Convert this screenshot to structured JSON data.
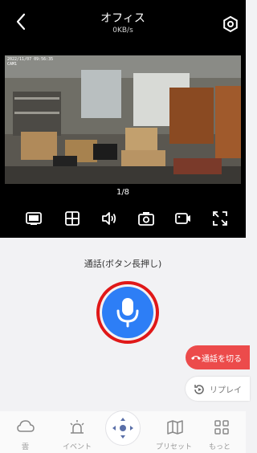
{
  "header": {
    "title": "オフィス",
    "bitrate": "0KB/s",
    "back_icon": "chevron-left-icon",
    "settings_icon": "gear-icon"
  },
  "video": {
    "timestamp": "2022/11/07 09:56:35",
    "camera_label": "CAM1",
    "page_indicator": "1/8"
  },
  "controls": [
    {
      "name": "sd-quality-button",
      "icon": "sd-icon"
    },
    {
      "name": "grid-layout-button",
      "icon": "grid-icon"
    },
    {
      "name": "sound-button",
      "icon": "speaker-icon"
    },
    {
      "name": "snapshot-button",
      "icon": "camera-icon"
    },
    {
      "name": "record-button",
      "icon": "video-record-icon"
    },
    {
      "name": "fullscreen-button",
      "icon": "fullscreen-icon"
    }
  ],
  "talk": {
    "hint": "通話(ボタン長押し)",
    "mic_icon": "microphone-icon",
    "hangup_label": "通話を切る",
    "replay_label": "リプレイ"
  },
  "bottom_nav": {
    "items": [
      {
        "label": "雲",
        "icon": "cloud-icon"
      },
      {
        "label": "イベント",
        "icon": "alarm-light-icon"
      },
      {
        "label": "プリセット",
        "icon": "map-icon"
      },
      {
        "label": "もっと",
        "icon": "grid-more-icon"
      }
    ],
    "ptz_icon": "ptz-joystick-icon"
  },
  "colors": {
    "accent_blue": "#2d7ef6",
    "highlight_red": "#e01818",
    "hangup_red": "#ec4b4b",
    "dark_bg": "#000000",
    "light_bg": "#f2f2f4"
  }
}
